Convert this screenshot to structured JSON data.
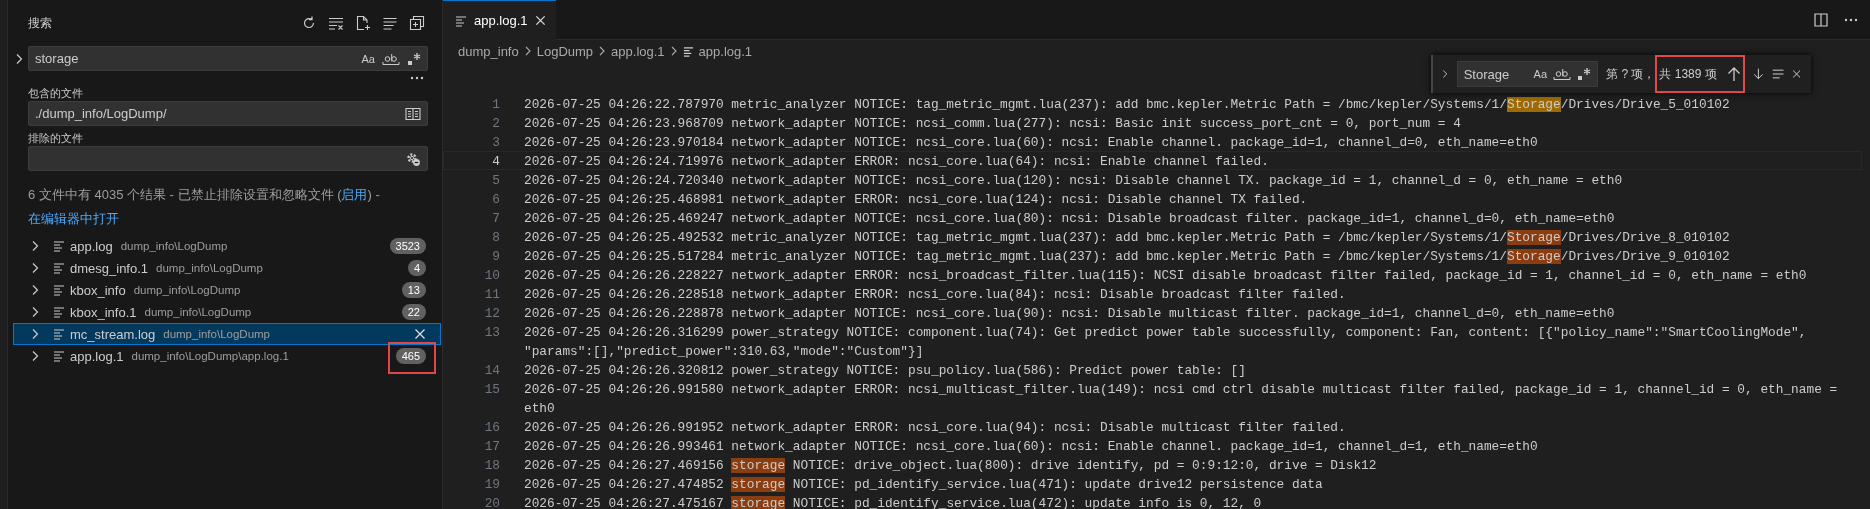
{
  "sidebar": {
    "title": "搜索",
    "search": {
      "query": "storage",
      "case_option": "Aa"
    },
    "include": {
      "label": "包含的文件",
      "value": "./dump_info/LogDump/"
    },
    "exclude": {
      "label": "排除的文件"
    },
    "message": [
      {
        "kind": "text",
        "text": "6 文件中有 4035 个结果 - 已禁止排除设置和忽略文件 ("
      },
      {
        "kind": "link",
        "text": "启用"
      },
      {
        "kind": "text",
        "text": ") - "
      },
      {
        "kind": "link",
        "text": "在编辑器中打开"
      }
    ],
    "results": [
      {
        "name": "app.log",
        "path": "dump_info\\LogDump",
        "count": "3523",
        "selected": false,
        "marked": false
      },
      {
        "name": "dmesg_info.1",
        "path": "dump_info\\LogDump",
        "count": "4",
        "selected": false,
        "marked": false
      },
      {
        "name": "kbox_info",
        "path": "dump_info\\LogDump",
        "count": "13",
        "selected": false,
        "marked": false
      },
      {
        "name": "kbox_info.1",
        "path": "dump_info\\LogDump",
        "count": "22",
        "selected": false,
        "marked": false
      },
      {
        "name": "mc_stream.log",
        "path": "dump_info\\LogDump",
        "selected": true,
        "marked": false
      },
      {
        "name": "app.log.1",
        "path": "dump_info\\LogDump\\app.log.1",
        "count": "465",
        "selected": false,
        "marked": true
      }
    ]
  },
  "editor": {
    "tabs": [
      {
        "label": "app.log.1",
        "selected": true
      }
    ],
    "breadcrumb": [
      "dump_info",
      "LogDump",
      "app.log.1",
      "app.log.1"
    ],
    "find": {
      "query": "Storage",
      "case_option": "Aa",
      "position": "第 ? 项，",
      "total": "共 1389 项",
      "marked": true
    },
    "lines": [
      {
        "number": "1",
        "current": false,
        "segments": [
          {
            "kind": "text",
            "text": "2026-07-25 04:26:22.787970 metric_analyzer NOTICE: tag_metric_mgmt.lua(237): add bmc.kepler.Metric Path = /bmc/kepler/Systems/1/"
          },
          {
            "kind": "current_match",
            "text": "Storage"
          },
          {
            "kind": "text",
            "text": "/Drives/Drive_5_010102"
          }
        ]
      },
      {
        "number": "2",
        "current": false,
        "text": "2026-07-25 04:26:23.968709 network_adapter NOTICE: ncsi_comm.lua(277): ncsi: Basic init success_port_cnt = 0, port_num = 4"
      },
      {
        "number": "3",
        "current": false,
        "text": "2026-07-25 04:26:23.970184 network_adapter NOTICE: ncsi_core.lua(60): ncsi: Enable channel. package_id=1, channel_d=0, eth_name=eth0"
      },
      {
        "number": "4",
        "current": true,
        "text": "2026-07-25 04:26:24.719976 network_adapter ERROR: ncsi_core.lua(64): ncsi: Enable channel failed."
      },
      {
        "number": "5",
        "current": false,
        "text": "2026-07-25 04:26:24.720340 network_adapter NOTICE: ncsi_core.lua(120): ncsi: Disable channel TX. package_id = 1, channel_d = 0, eth_name = eth0"
      },
      {
        "number": "6",
        "current": false,
        "text": "2026-07-25 04:26:25.468981 network_adapter ERROR: ncsi_core.lua(124): ncsi: Disable channel TX failed."
      },
      {
        "number": "7",
        "current": false,
        "text": "2026-07-25 04:26:25.469247 network_adapter NOTICE: ncsi_core.lua(80): ncsi: Disable broadcast filter. package_id=1, channel_d=0, eth_name=eth0"
      },
      {
        "number": "8",
        "current": false,
        "segments": [
          {
            "kind": "text",
            "text": "2026-07-25 04:26:25.492532 metric_analyzer NOTICE: tag_metric_mgmt.lua(237): add bmc.kepler.Metric Path = /bmc/kepler/Systems/1/"
          },
          {
            "kind": "match",
            "text": "Storage"
          },
          {
            "kind": "text",
            "text": "/Drives/Drive_8_010102"
          }
        ]
      },
      {
        "number": "9",
        "current": false,
        "segments": [
          {
            "kind": "text",
            "text": "2026-07-25 04:26:25.517284 metric_analyzer NOTICE: tag_metric_mgmt.lua(237): add bmc.kepler.Metric Path = /bmc/kepler/Systems/1/"
          },
          {
            "kind": "match",
            "text": "Storage"
          },
          {
            "kind": "text",
            "text": "/Drives/Drive_9_010102"
          }
        ]
      },
      {
        "number": "10",
        "current": false,
        "text": "2026-07-25 04:26:26.228227 network_adapter ERROR: ncsi_broadcast_filter.lua(115): NCSI disable broadcast filter failed, package_id = 1, channel_id = 0, eth_name = eth0"
      },
      {
        "number": "11",
        "current": false,
        "text": "2026-07-25 04:26:26.228518 network_adapter ERROR: ncsi_core.lua(84): ncsi: Disable broadcast filter failed."
      },
      {
        "number": "12",
        "current": false,
        "text": "2026-07-25 04:26:26.228878 network_adapter NOTICE: ncsi_core.lua(90): ncsi: Disable multicast filter. package_id=1, channel_d=0, eth_name=eth0"
      },
      {
        "number": "13",
        "current": false,
        "text": "2026-07-25 04:26:26.316299 power_strategy NOTICE: component.lua(74): Get predict power table successfully, component: Fan, content: [{\"policy_name\":\"SmartCoolingMode\",",
        "wrap": "\"params\":[],\"predict_power\":310.63,\"mode\":\"Custom\"}]"
      },
      {
        "number": "14",
        "current": false,
        "text": "2026-07-25 04:26:26.320812 power_strategy NOTICE: psu_policy.lua(586): Predict power table: []"
      },
      {
        "number": "15",
        "current": false,
        "text": "2026-07-25 04:26:26.991580 network_adapter ERROR: ncsi_multicast_filter.lua(149): ncsi cmd ctrl disable multicast filter failed, package_id = 1, channel_id = 0, eth_name =",
        "wrap": "eth0"
      },
      {
        "number": "16",
        "current": false,
        "text": "2026-07-25 04:26:26.991952 network_adapter ERROR: ncsi_core.lua(94): ncsi: Disable multicast filter failed."
      },
      {
        "number": "17",
        "current": false,
        "text": "2026-07-25 04:26:26.993461 network_adapter NOTICE: ncsi_core.lua(60): ncsi: Enable channel. package_id=1, channel_d=1, eth_name=eth0"
      },
      {
        "number": "18",
        "current": false,
        "segments": [
          {
            "kind": "text",
            "text": "2026-07-25 04:26:27.469156 "
          },
          {
            "kind": "match",
            "text": "storage"
          },
          {
            "kind": "text",
            "text": " NOTICE: drive_object.lua(800): drive identify, pd = 0:9:12:0, drive = Disk12"
          }
        ]
      },
      {
        "number": "19",
        "current": false,
        "segments": [
          {
            "kind": "text",
            "text": "2026-07-25 04:26:27.474852 "
          },
          {
            "kind": "match",
            "text": "storage"
          },
          {
            "kind": "text",
            "text": " NOTICE: pd_identify_service.lua(471): update drive12 persistence data"
          }
        ]
      },
      {
        "number": "20",
        "current": false,
        "segments": [
          {
            "kind": "text",
            "text": "2026-07-25 04:26:27.475167 "
          },
          {
            "kind": "match",
            "text": "storage"
          },
          {
            "kind": "text",
            "text": " NOTICE: pd_identify_service.lua(472): update info is 0, 12, 0"
          }
        ]
      }
    ]
  }
}
